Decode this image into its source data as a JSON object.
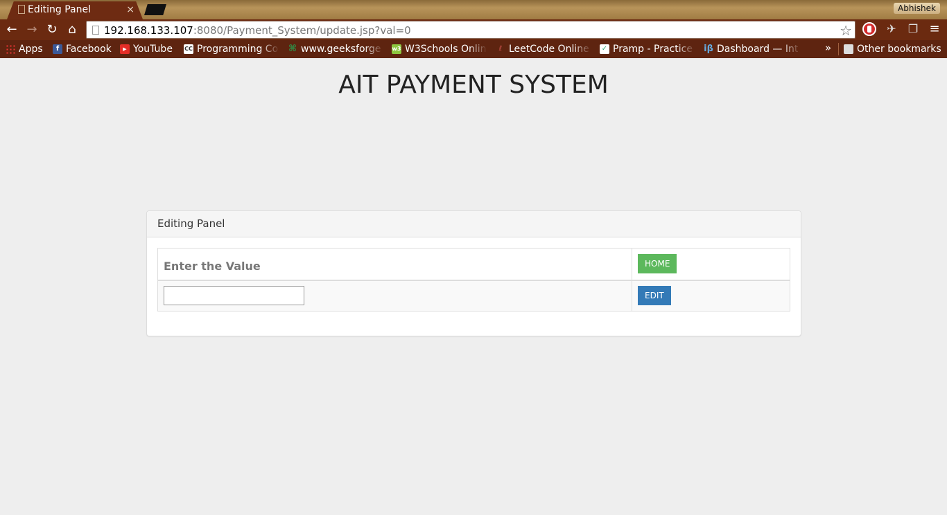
{
  "browser": {
    "tab_title": "Editing Panel",
    "tab_close": "×",
    "profile_name": "Abhishek",
    "url_host": "192.168.133.107",
    "url_rest": ":8080/Payment_System/update.jsp?val=0",
    "nav": {
      "back": "←",
      "forward": "→",
      "reload": "↻",
      "home": "⌂"
    },
    "star": "☆",
    "menu": "≡",
    "more": "»",
    "bookmarks": [
      {
        "label": "Apps",
        "icon": "apps-grid-icon",
        "glyph": ""
      },
      {
        "label": "Facebook",
        "icon": "facebook-icon",
        "glyph": "f"
      },
      {
        "label": "YouTube",
        "icon": "youtube-icon",
        "glyph": "▶"
      },
      {
        "label": "Programming Co",
        "icon": "codechef-icon",
        "glyph": "CC"
      },
      {
        "label": "www.geeksforge",
        "icon": "geeksforgeeks-icon",
        "glyph": "⌘"
      },
      {
        "label": "W3Schools Onlin",
        "icon": "w3schools-icon",
        "glyph": "w3"
      },
      {
        "label": "LeetCode Online",
        "icon": "leetcode-icon",
        "glyph": "ℓ"
      },
      {
        "label": "Pramp - Practice",
        "icon": "pramp-icon",
        "glyph": "✓"
      },
      {
        "label": "Dashboard — Int",
        "icon": "interviewbit-icon",
        "glyph": "iβ"
      }
    ],
    "other_bookmarks": "Other bookmarks"
  },
  "page": {
    "title": "AIT PAYMENT SYSTEM",
    "panel": {
      "heading": "Editing Panel",
      "field_label": "Enter the Value",
      "input_value": "",
      "home_button": "HOME",
      "edit_button": "EDIT"
    }
  },
  "colors": {
    "home_button": "#5cb85c",
    "edit_button": "#337ab7",
    "page_background": "#eeeeee"
  }
}
